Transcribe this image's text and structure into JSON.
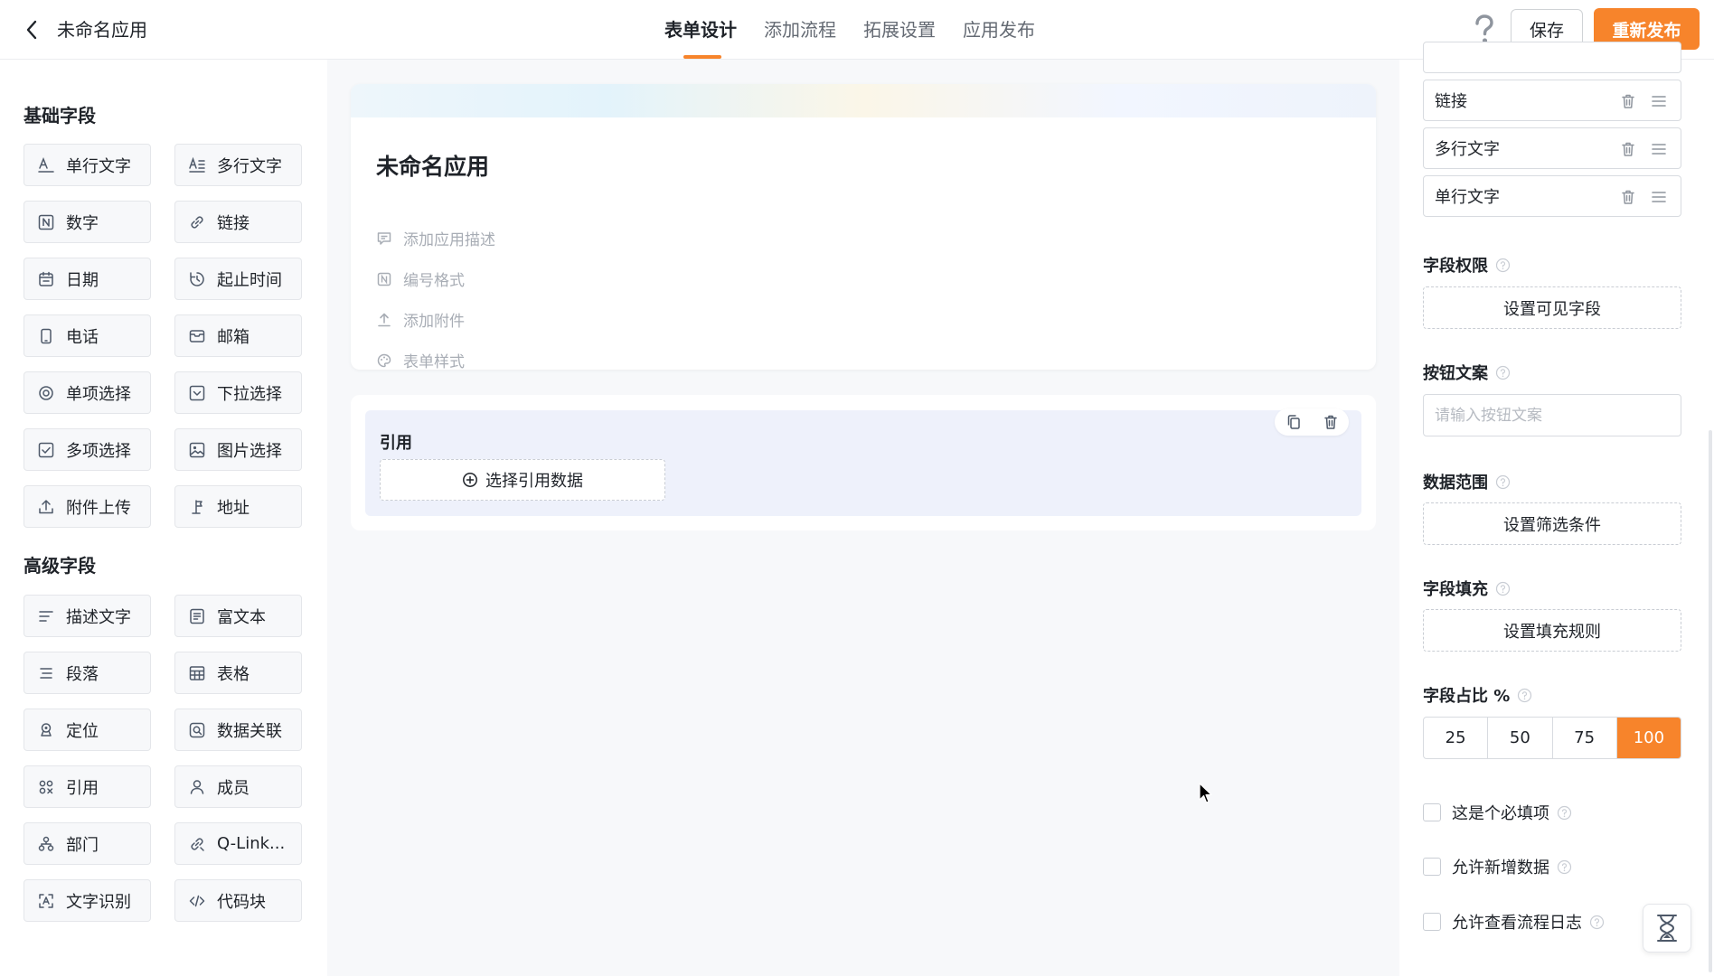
{
  "header": {
    "app_title": "未命名应用",
    "tabs": [
      {
        "label": "表单设计",
        "active": true
      },
      {
        "label": "添加流程",
        "active": false
      },
      {
        "label": "拓展设置",
        "active": false
      },
      {
        "label": "应用发布",
        "active": false
      }
    ],
    "save_label": "保存",
    "publish_label": "重新发布"
  },
  "left_panel": {
    "basic_title": "基础字段",
    "basic_fields": [
      {
        "label": "单行文字",
        "icon": "single-line-text-icon"
      },
      {
        "label": "多行文字",
        "icon": "multi-line-text-icon"
      },
      {
        "label": "数字",
        "icon": "number-icon"
      },
      {
        "label": "链接",
        "icon": "link-icon"
      },
      {
        "label": "日期",
        "icon": "calendar-icon"
      },
      {
        "label": "起止时间",
        "icon": "time-range-icon"
      },
      {
        "label": "电话",
        "icon": "phone-icon"
      },
      {
        "label": "邮箱",
        "icon": "mail-icon"
      },
      {
        "label": "单项选择",
        "icon": "radio-icon"
      },
      {
        "label": "下拉选择",
        "icon": "dropdown-icon"
      },
      {
        "label": "多项选择",
        "icon": "checkbox-icon"
      },
      {
        "label": "图片选择",
        "icon": "image-icon"
      },
      {
        "label": "附件上传",
        "icon": "upload-icon"
      },
      {
        "label": "地址",
        "icon": "address-icon"
      }
    ],
    "advanced_title": "高级字段",
    "advanced_fields": [
      {
        "label": "描述文字",
        "icon": "description-icon"
      },
      {
        "label": "富文本",
        "icon": "rich-text-icon"
      },
      {
        "label": "段落",
        "icon": "paragraph-icon"
      },
      {
        "label": "表格",
        "icon": "table-icon"
      },
      {
        "label": "定位",
        "icon": "location-icon"
      },
      {
        "label": "数据关联",
        "icon": "data-link-icon"
      },
      {
        "label": "引用",
        "icon": "reference-icon"
      },
      {
        "label": "成员",
        "icon": "member-icon"
      },
      {
        "label": "部门",
        "icon": "department-icon"
      },
      {
        "label": "Q-Link...",
        "icon": "qlink-icon"
      },
      {
        "label": "文字识别",
        "icon": "ocr-icon"
      },
      {
        "label": "代码块",
        "icon": "code-icon"
      }
    ]
  },
  "canvas": {
    "form_title": "未命名应用",
    "meta_items": [
      {
        "label": "添加应用描述",
        "icon": "comment-icon"
      },
      {
        "label": "编号格式",
        "icon": "number-format-icon"
      },
      {
        "label": "添加附件",
        "icon": "upload-icon"
      },
      {
        "label": "表单样式",
        "icon": "palette-icon"
      }
    ],
    "field_label": "引用",
    "field_button": "选择引用数据"
  },
  "right_panel": {
    "list_items": [
      "链接",
      "多行文字",
      "单行文字"
    ],
    "field_permission": {
      "title": "字段权限",
      "button": "设置可见字段"
    },
    "button_text": {
      "title": "按钮文案",
      "placeholder": "请输入按钮文案"
    },
    "data_range": {
      "title": "数据范围",
      "button": "设置筛选条件"
    },
    "field_fill": {
      "title": "字段填充",
      "button": "设置填充规则"
    },
    "field_ratio": {
      "title": "字段占比 %",
      "options": [
        "25",
        "50",
        "75",
        "100"
      ],
      "selected": "100"
    },
    "checks": [
      {
        "label": "这是个必填项",
        "checked": false
      },
      {
        "label": "允许新增数据",
        "checked": false
      },
      {
        "label": "允许查看流程日志",
        "checked": false
      }
    ]
  },
  "colors": {
    "accent": "#f7842b",
    "field_bg": "#eef1fb"
  }
}
